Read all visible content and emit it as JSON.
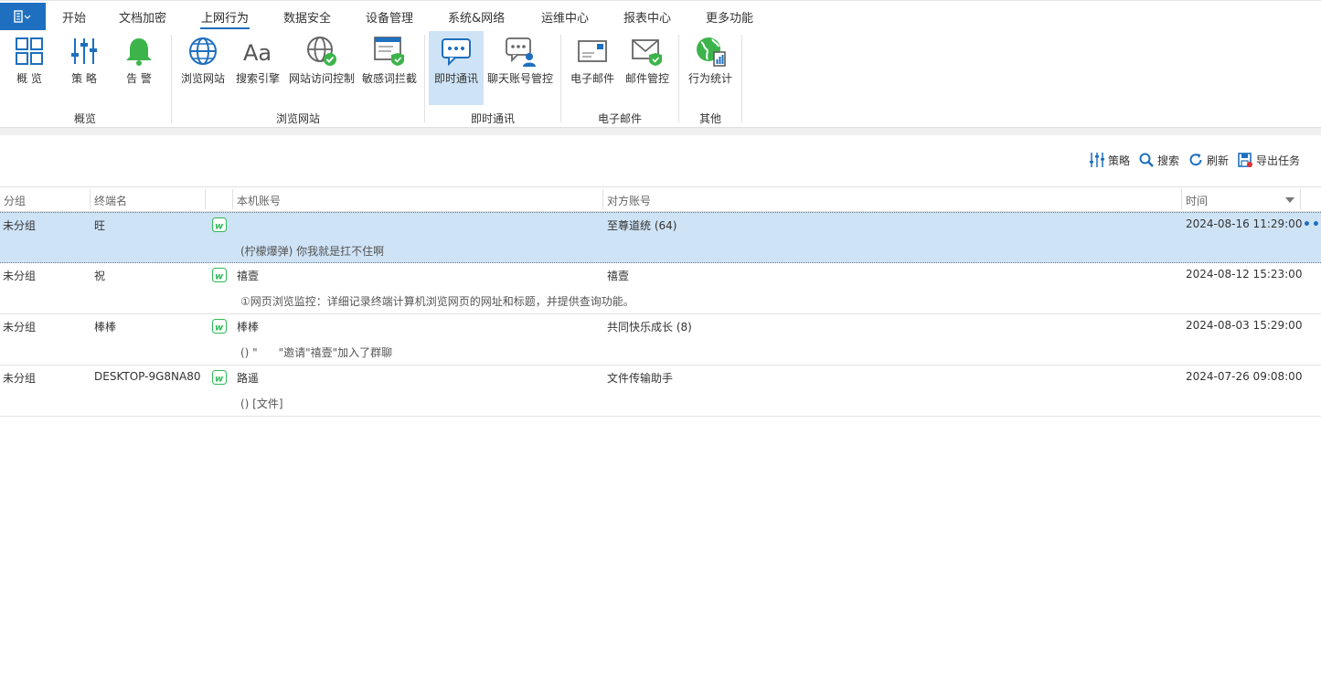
{
  "menu": {
    "app_button_icon": "app-menu-icon",
    "tabs": [
      "开始",
      "文档加密",
      "上网行为",
      "数据安全",
      "设备管理",
      "系统&网络",
      "运维中心",
      "报表中心",
      "更多功能"
    ],
    "active_tab": "上网行为"
  },
  "ribbon": {
    "buttons": [
      {
        "label": "概 览",
        "icon": "overview-grid-icon"
      },
      {
        "label": "策 略",
        "icon": "policy-sliders-icon"
      },
      {
        "label": "告 警",
        "icon": "alarm-bell-icon"
      },
      {
        "label": "浏览网站",
        "icon": "globe-icon"
      },
      {
        "label": "搜索引擎",
        "icon": "search-engine-aa-icon"
      },
      {
        "label": "网站访问控制",
        "icon": "globe-check-icon"
      },
      {
        "label": "敏感词拦截",
        "icon": "window-shield-icon"
      },
      {
        "label": "即时通讯",
        "icon": "chat-bubble-icon"
      },
      {
        "label": "聊天账号管控",
        "icon": "chat-user-icon"
      },
      {
        "label": "电子邮件",
        "icon": "envelope-icon"
      },
      {
        "label": "邮件管控",
        "icon": "envelope-shield-icon"
      },
      {
        "label": "行为统计",
        "icon": "globe-stats-icon"
      }
    ],
    "selected_button": "即时通讯",
    "groups": [
      "概览",
      "浏览网站",
      "即时通讯",
      "电子邮件",
      "其他"
    ]
  },
  "toolbar": {
    "policy": "策略",
    "search": "搜索",
    "refresh": "刷新",
    "export": "导出任务"
  },
  "table": {
    "columns": [
      "分组",
      "终端名",
      "本机账号",
      "对方账号",
      "时间"
    ],
    "sort_column": "时间",
    "rows": [
      {
        "group": "未分组",
        "terminal": "旺",
        "app_icon": "wechat-icon",
        "local_account": "",
        "peer_account": "至尊道统 (64)",
        "time": "2024-08-16 11:29:00",
        "message": "(柠檬爆弹) 你我就是扛不住啊",
        "selected": true
      },
      {
        "group": "未分组",
        "terminal": "祝",
        "app_icon": "wechat-icon",
        "local_account": "禧壹",
        "peer_account": "禧壹",
        "time": "2024-08-12 15:23:00",
        "message": "①网页浏览监控：详细记录终端计算机浏览网页的网址和标题，并提供查询功能。",
        "selected": false
      },
      {
        "group": "未分组",
        "terminal": "棒棒",
        "app_icon": "wechat-icon",
        "local_account": "棒棒",
        "peer_account": "共同快乐成长 (8)",
        "time": "2024-08-03 15:29:00",
        "message": "() \"      \"邀请\"禧壹\"加入了群聊",
        "selected": false
      },
      {
        "group": "未分组",
        "terminal": "DESKTOP-9G8NA80",
        "app_icon": "wechat-icon",
        "local_account": "路遥",
        "peer_account": "文件传输助手",
        "time": "2024-07-26 09:08:00",
        "message": "() [文件]",
        "selected": false
      }
    ]
  },
  "colors": {
    "accent": "#1e6fbf",
    "selection": "#cfe3f6",
    "wechat_green": "#2dbb55"
  }
}
